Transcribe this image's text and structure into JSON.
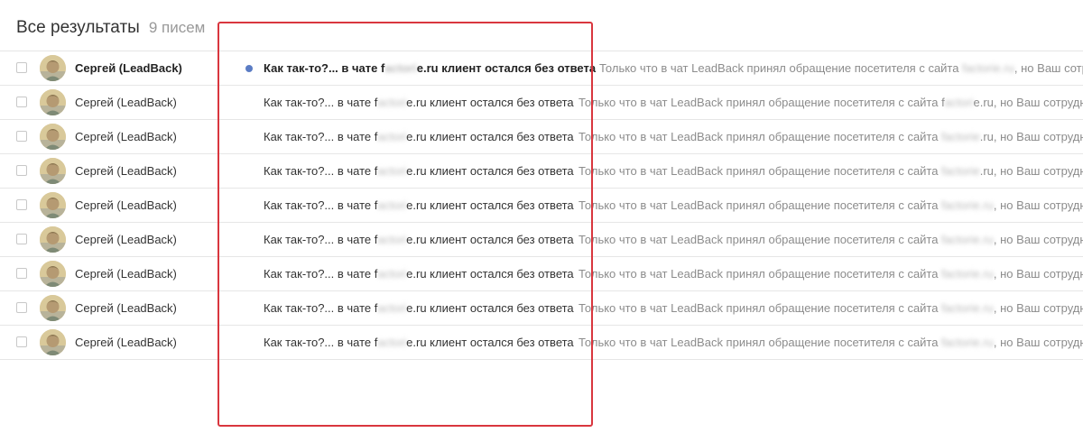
{
  "header": {
    "title": "Все результаты",
    "count": "9 писем"
  },
  "colors": {
    "unread_dot": "#5b7cc4",
    "highlight_box": "#d9363e"
  },
  "rows": [
    {
      "unread": true,
      "sender": "Сергей (LeadBack)",
      "subject_start": "Как так-то?... в чате f",
      "subject_blurred": "actori",
      "subject_end": "e.ru клиент остался без ответа",
      "snippet_start": "Только что в чат LeadBack принял обращение посетителя с сайта ",
      "snippet_site": "factorie.ru",
      "snippet_end": ", но Ваш сотрудник не ответил"
    },
    {
      "unread": false,
      "sender": "Сергей (LeadBack)",
      "subject_start": "Как так-то?... в чате f",
      "subject_blurred": "actori",
      "subject_end": "e.ru клиент остался без ответа",
      "snippet_start": "Только что в чат LeadBack принял обращение посетителя с сайта f",
      "snippet_site": "actori",
      "snippet_end": "e.ru, но Ваш сотрудник не ответил"
    },
    {
      "unread": false,
      "sender": "Сергей (LeadBack)",
      "subject_start": "Как так-то?... в чате f",
      "subject_blurred": "actori",
      "subject_end": "e.ru клиент остался без ответа",
      "snippet_start": "Только что в чат LeadBack принял обращение посетителя с сайта ",
      "snippet_site": "factorie",
      "snippet_end": ".ru, но Ваш сотрудник не ответил"
    },
    {
      "unread": false,
      "sender": "Сергей (LeadBack)",
      "subject_start": "Как так-то?... в чате f",
      "subject_blurred": "actori",
      "subject_end": "e.ru клиент остался без ответа",
      "snippet_start": "Только что в чат LeadBack принял обращение посетителя с сайта ",
      "snippet_site": "factorie",
      "snippet_end": ".ru, но Ваш сотрудник не ответил"
    },
    {
      "unread": false,
      "sender": "Сергей (LeadBack)",
      "subject_start": "Как так-то?... в чате f",
      "subject_blurred": "actori",
      "subject_end": "e.ru клиент остался без ответа",
      "snippet_start": "Только что в чат LeadBack принял обращение посетителя с сайта ",
      "snippet_site": "factorie.ru",
      "snippet_end": ", но Ваш сотрудник не ответил"
    },
    {
      "unread": false,
      "sender": "Сергей (LeadBack)",
      "subject_start": "Как так-то?... в чате f",
      "subject_blurred": "actori",
      "subject_end": "e.ru клиент остался без ответа",
      "snippet_start": "Только что в чат LeadBack принял обращение посетителя с сайта ",
      "snippet_site": "factorie.ru",
      "snippet_end": ", но Ваш сотрудник не ответил"
    },
    {
      "unread": false,
      "sender": "Сергей (LeadBack)",
      "subject_start": "Как так-то?... в чате f",
      "subject_blurred": "actori",
      "subject_end": "e.ru клиент остался без ответа",
      "snippet_start": "Только что в чат LeadBack принял обращение посетителя с сайта ",
      "snippet_site": "factorie.ru",
      "snippet_end": ", но Ваш сотрудник не ответил"
    },
    {
      "unread": false,
      "sender": "Сергей (LeadBack)",
      "subject_start": "Как так-то?... в чате f",
      "subject_blurred": "actori",
      "subject_end": "e.ru клиент остался без ответа",
      "snippet_start": "Только что в чат LeadBack принял обращение посетителя с сайта ",
      "snippet_site": "factorie.ru",
      "snippet_end": ", но Ваш сотрудник не ответил"
    },
    {
      "unread": false,
      "sender": "Сергей (LeadBack)",
      "subject_start": "Как так-то?... в чате f",
      "subject_blurred": "actori",
      "subject_end": "e.ru клиент остался без ответа",
      "snippet_start": "Только что в чат LeadBack принял обращение посетителя с сайта ",
      "snippet_site": "factorie.ru",
      "snippet_end": ", но Ваш сотрудник не ответил"
    }
  ]
}
